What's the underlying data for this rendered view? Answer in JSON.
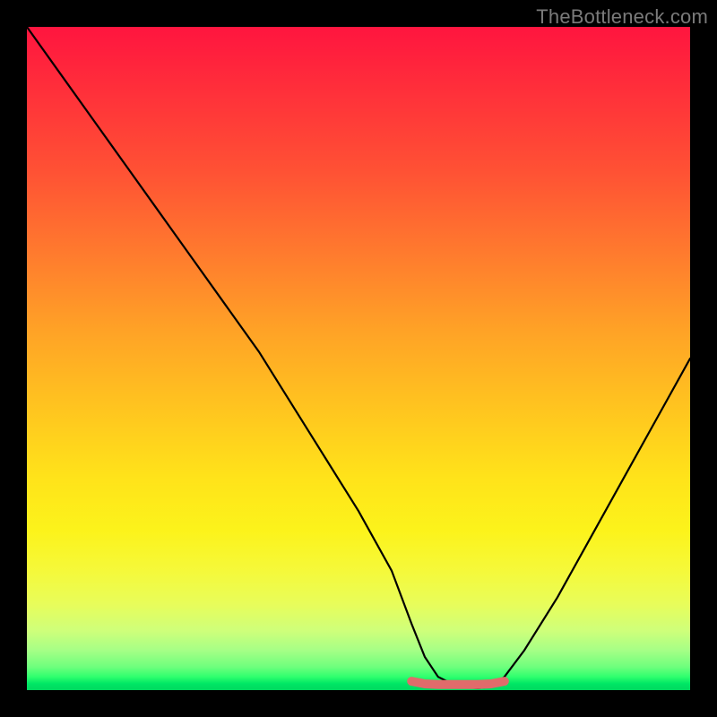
{
  "watermark": "TheBottleneck.com",
  "chart_data": {
    "type": "line",
    "title": "",
    "xlabel": "",
    "ylabel": "",
    "xlim": [
      0,
      100
    ],
    "ylim": [
      0,
      100
    ],
    "x": [
      0,
      5,
      10,
      15,
      20,
      25,
      30,
      35,
      40,
      45,
      50,
      55,
      58,
      60,
      62,
      65,
      68,
      70,
      72,
      75,
      80,
      85,
      90,
      95,
      100
    ],
    "values": [
      100,
      93,
      86,
      79,
      72,
      65,
      58,
      51,
      43,
      35,
      27,
      18,
      10,
      5,
      2,
      0.5,
      0.3,
      0.5,
      2,
      6,
      14,
      23,
      32,
      41,
      50
    ],
    "annotations": {
      "marker_segment_x": [
        58,
        60,
        62,
        64,
        66,
        68,
        70,
        72
      ],
      "marker_segment_y": [
        0.8,
        0.4,
        0.3,
        0.3,
        0.3,
        0.3,
        0.4,
        0.8
      ],
      "marker_color": "#e06b6b"
    },
    "gradient_stops": [
      {
        "pos": 0,
        "color": "#ff153f"
      },
      {
        "pos": 50,
        "color": "#ffb022"
      },
      {
        "pos": 75,
        "color": "#fcf020"
      },
      {
        "pos": 100,
        "color": "#00d85f"
      }
    ]
  }
}
